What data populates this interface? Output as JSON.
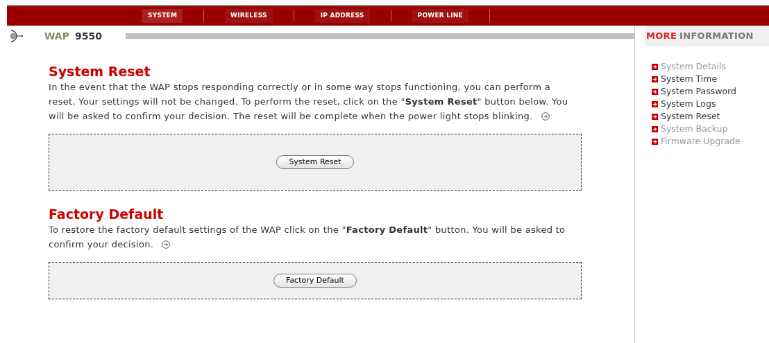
{
  "nav": [
    {
      "label": "SYSTEM",
      "selected": true
    },
    {
      "label": "WIRELESS",
      "selected": false
    },
    {
      "label": "IP ADDRESS",
      "selected": false
    },
    {
      "label": "POWER LINE",
      "selected": false
    }
  ],
  "product": {
    "brand": "WAP",
    "model": "9550"
  },
  "sections": [
    {
      "title": "System Reset",
      "text": "In the event that the WAP stops responding correctly or in some way stops functioning, you can perform a reset. Your settings will not be changed. To perform the reset, click on the \"**System Reset**\" button below. You will be asked to confirm your decision. The reset will be complete when the power light stops blinking.",
      "button": "System Reset"
    },
    {
      "title": "Factory Default",
      "text": "To restore the factory default settings of the WAP click on the \"**Factory Default**\" button. You will be asked to confirm your decision.",
      "button": "Factory Default"
    }
  ],
  "sidebar": {
    "title_accent": "MORE",
    "title": "INFORMATION",
    "items": [
      {
        "label": "System Details",
        "disabled": true
      },
      {
        "label": "System Time",
        "disabled": false
      },
      {
        "label": "System Password",
        "disabled": false
      },
      {
        "label": "System Logs",
        "disabled": false
      },
      {
        "label": "System Reset",
        "disabled": false
      },
      {
        "label": "System Backup",
        "disabled": true
      },
      {
        "label": "Firmware Upgrade",
        "disabled": true
      }
    ]
  }
}
